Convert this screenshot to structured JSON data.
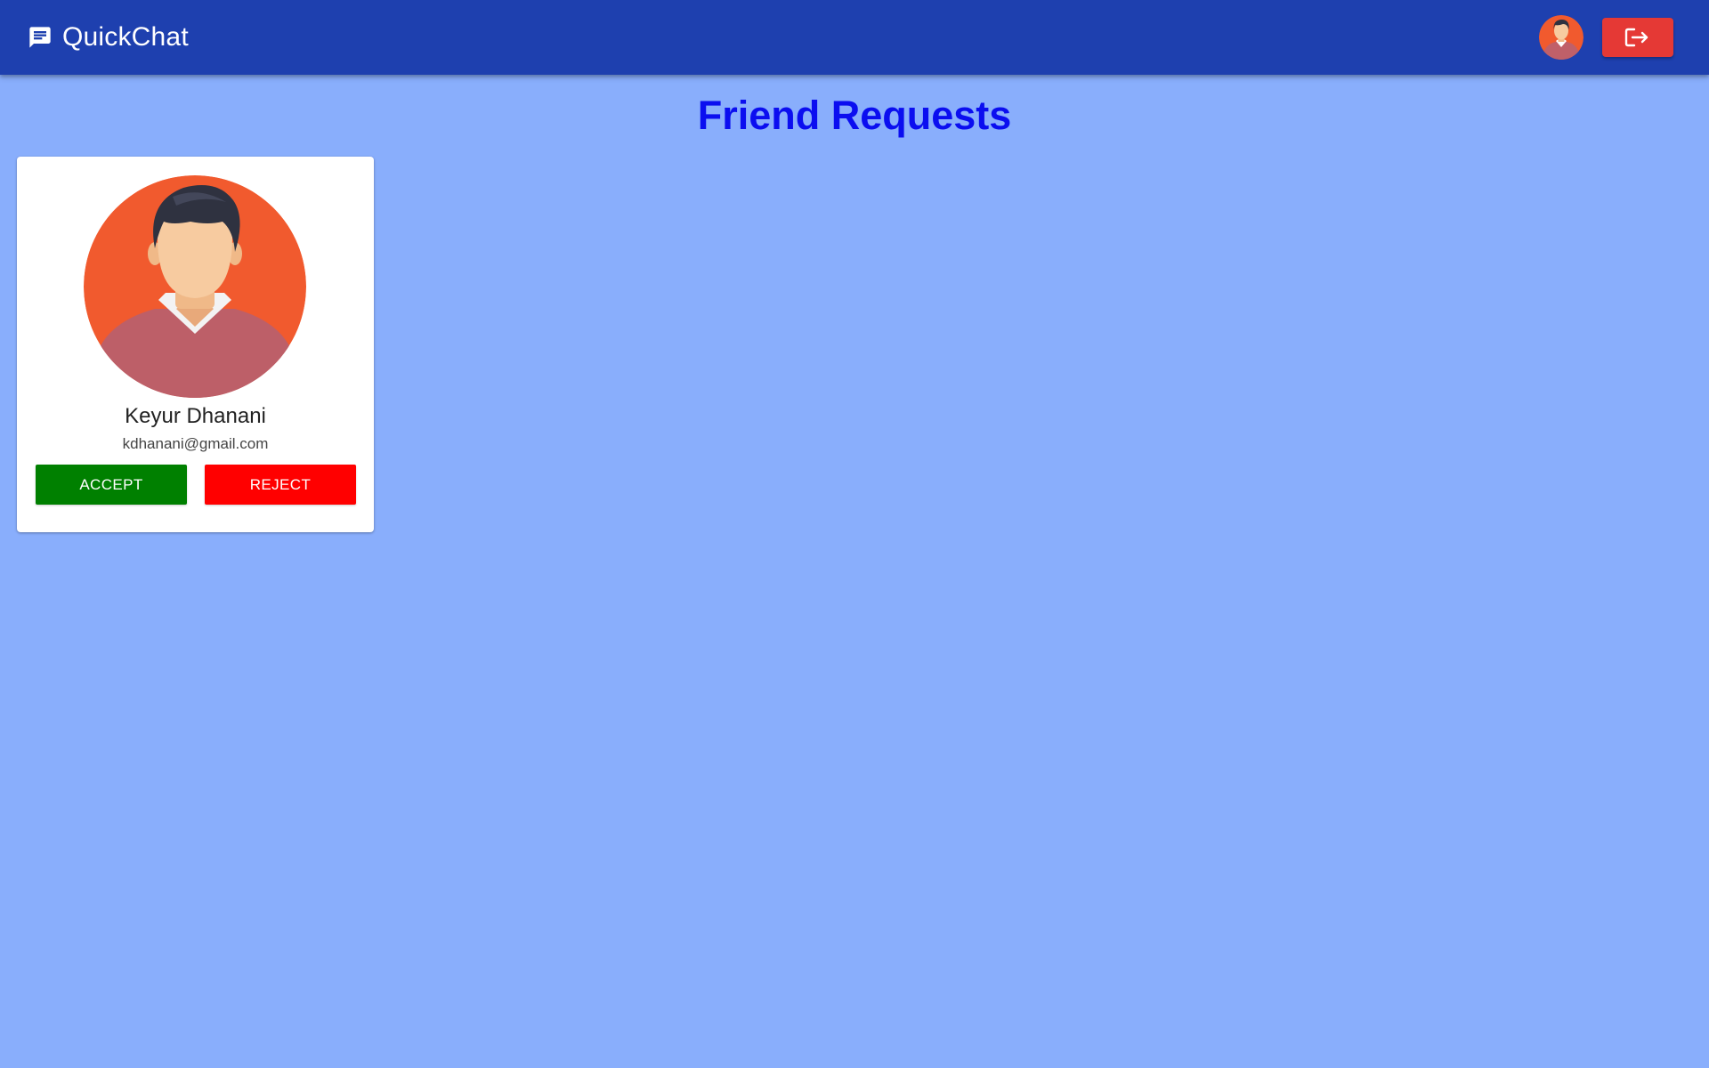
{
  "app": {
    "title": "QuickChat",
    "icon": "chat-bubble-icon",
    "header_color": "#1e40af"
  },
  "header": {
    "avatar_icon": "user-avatar-icon",
    "logout_icon": "logout-icon",
    "logout_color": "#e53935"
  },
  "page": {
    "title": "Friend Requests",
    "title_color": "#0b0ef0",
    "background": "#89aefc"
  },
  "requests": [
    {
      "name": "Keyur Dhanani",
      "email": "kdhanani@gmail.com",
      "avatar_icon": "male-avatar-icon",
      "accept_label": "ACCEPT",
      "reject_label": "REJECT",
      "accept_color": "#008000",
      "reject_color": "#ff0000"
    }
  ]
}
